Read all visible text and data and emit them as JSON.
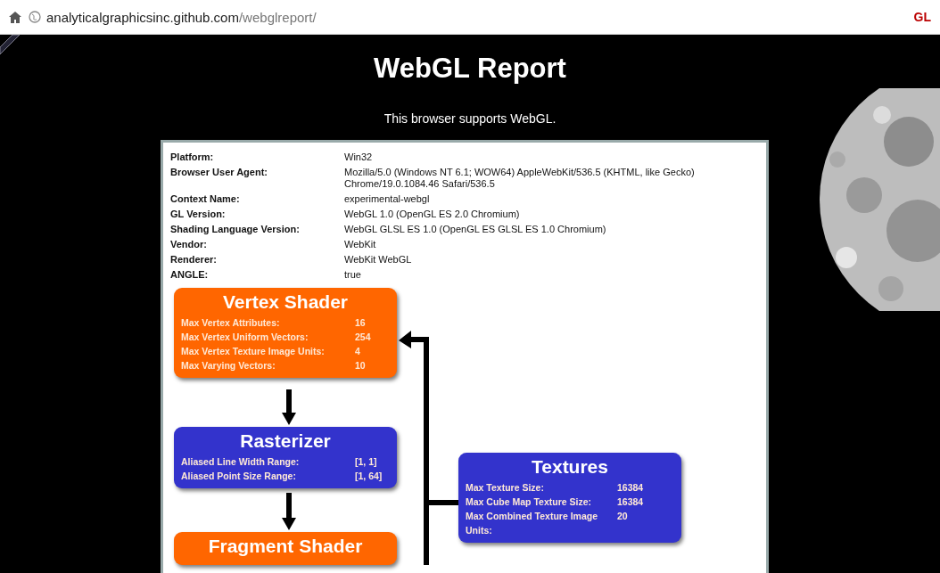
{
  "address_bar": {
    "host": "analyticalgraphicsinc.github.com",
    "path": "/webglreport/",
    "extension": "GL"
  },
  "page": {
    "title": "WebGL Report",
    "subtitle": "This browser supports WebGL."
  },
  "info": [
    {
      "label": "Platform:",
      "value": "Win32"
    },
    {
      "label": "Browser User Agent:",
      "value": "Mozilla/5.0 (Windows NT 6.1; WOW64) AppleWebKit/536.5 (KHTML, like Gecko) Chrome/19.0.1084.46 Safari/536.5"
    },
    {
      "label": "Context Name:",
      "value": "experimental-webgl"
    },
    {
      "label": "GL Version:",
      "value": "WebGL 1.0 (OpenGL ES 2.0 Chromium)"
    },
    {
      "label": "Shading Language Version:",
      "value": "WebGL GLSL ES 1.0 (OpenGL ES GLSL ES 1.0 Chromium)"
    },
    {
      "label": "Vendor:",
      "value": "WebKit"
    },
    {
      "label": "Renderer:",
      "value": "WebKit WebGL"
    },
    {
      "label": "ANGLE:",
      "value": "true"
    }
  ],
  "pipeline": [
    {
      "title": "Vertex Shader",
      "color": "#ff6600",
      "rows": [
        {
          "label": "Max Vertex Attributes:",
          "value": "16"
        },
        {
          "label": "Max Vertex Uniform Vectors:",
          "value": "254"
        },
        {
          "label": "Max Vertex Texture Image Units:",
          "value": "4"
        },
        {
          "label": "Max Varying Vectors:",
          "value": "10"
        }
      ]
    },
    {
      "title": "Rasterizer",
      "color": "#3333cc",
      "rows": [
        {
          "label": "Aliased Line Width Range:",
          "value": "[1, 1]"
        },
        {
          "label": "Aliased Point Size Range:",
          "value": "[1, 64]"
        }
      ]
    },
    {
      "title": "Fragment Shader",
      "color": "#ff6600"
    },
    {
      "title": "Textures",
      "color": "#3333cc",
      "rows": [
        {
          "label": "Max Texture Size:",
          "value": "16384"
        },
        {
          "label": "Max Cube Map Texture Size:",
          "value": "16384"
        },
        {
          "label": "Max Combined Texture Image Units:",
          "value": "20"
        }
      ]
    }
  ]
}
